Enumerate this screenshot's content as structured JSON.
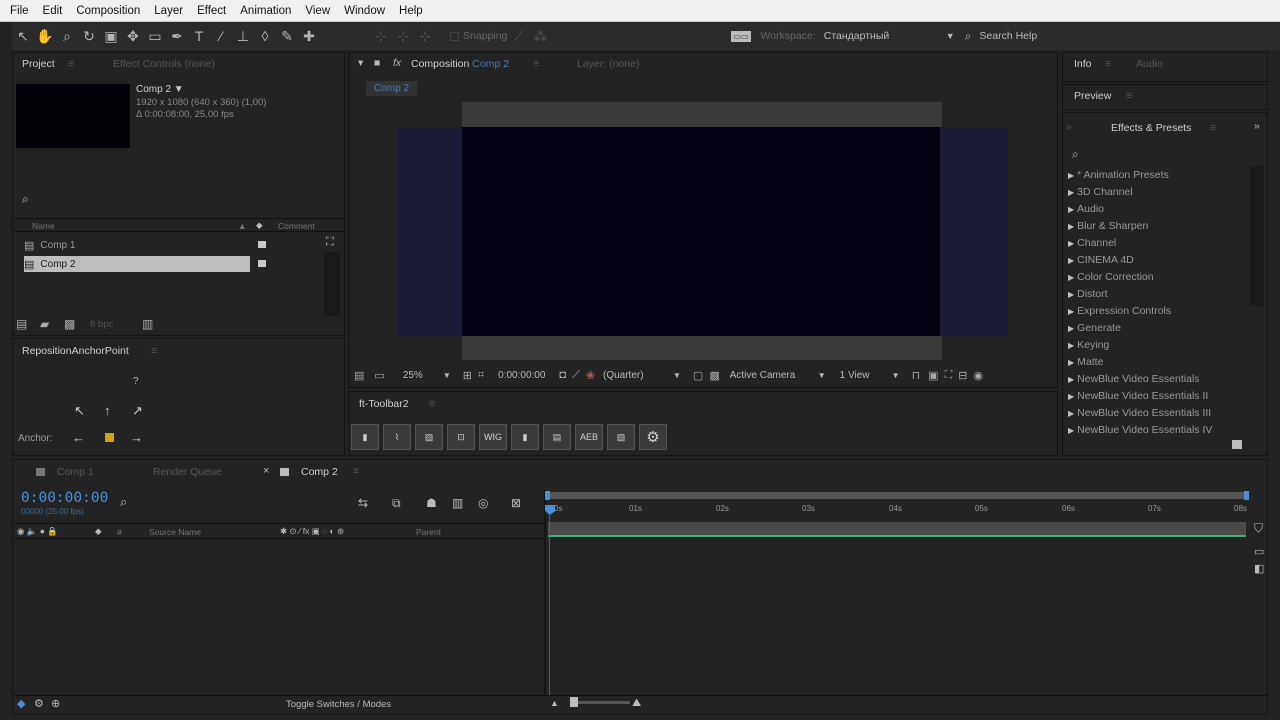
{
  "menu": [
    "File",
    "Edit",
    "Composition",
    "Layer",
    "Effect",
    "Animation",
    "View",
    "Window",
    "Help"
  ],
  "toolbar": {
    "snapping": "Snapping",
    "workspace_label": "Workspace:",
    "workspace_value": "Стандартный",
    "search_help": "Search Help"
  },
  "project": {
    "tab": "Project",
    "tab2": "Effect Controls (none)",
    "comp_name": "Comp 2 ▼",
    "comp_info1": "1920 x 1080  (640 x 360) (1,00)",
    "comp_info2": "Δ 0:00:08:00, 25,00 fps",
    "col_name": "Name",
    "col_comment": "Comment",
    "items": [
      "Comp 1",
      "Comp 2"
    ],
    "bpc": "8 bpc"
  },
  "anchor": {
    "title": "RepositionAnchorPoint",
    "q": "?",
    "label": "Anchor:"
  },
  "composition": {
    "tab": "Composition",
    "tab_comp": "Comp 2",
    "tab_layer": "Layer: (none)",
    "sub_tab": "Comp 2",
    "zoom": "25%",
    "timecode": "0:00:00:00",
    "resolution": "(Quarter)",
    "camera": "Active Camera",
    "views": "1 View"
  },
  "fttoolbar": {
    "title": "ft-Toolbar2",
    "wig": "WIG",
    "aeb": "AEB"
  },
  "right": {
    "info": "Info",
    "audio": "Audio",
    "preview": "Preview",
    "effects": "Effects & Presets",
    "items": [
      "* Animation Presets",
      "3D Channel",
      "Audio",
      "Blur & Sharpen",
      "Channel",
      "CINEMA 4D",
      "Color Correction",
      "Distort",
      "Expression Controls",
      "Generate",
      "Keying",
      "Matte",
      "NewBlue Video Essentials",
      "NewBlue Video Essentials II",
      "NewBlue Video Essentials III",
      "NewBlue Video Essentials IV"
    ]
  },
  "timeline": {
    "tabs": [
      "Comp 1",
      "Render Queue",
      "Comp 2"
    ],
    "timecode": "0:00:00:00",
    "frames": "00000 (25.00 fps)",
    "source_name": "Source Name",
    "parent": "Parent",
    "ruler": [
      "0s",
      "01s",
      "02s",
      "03s",
      "04s",
      "05s",
      "06s",
      "07s",
      "08s"
    ],
    "toggle": "Toggle Switches / Modes"
  },
  "colors": {
    "bg": "#232323",
    "comp_frame": "#1c1c3a",
    "comp_inner": "#020212",
    "accent_blue": "#4a90d9",
    "work_area_green": "#3cb371"
  }
}
